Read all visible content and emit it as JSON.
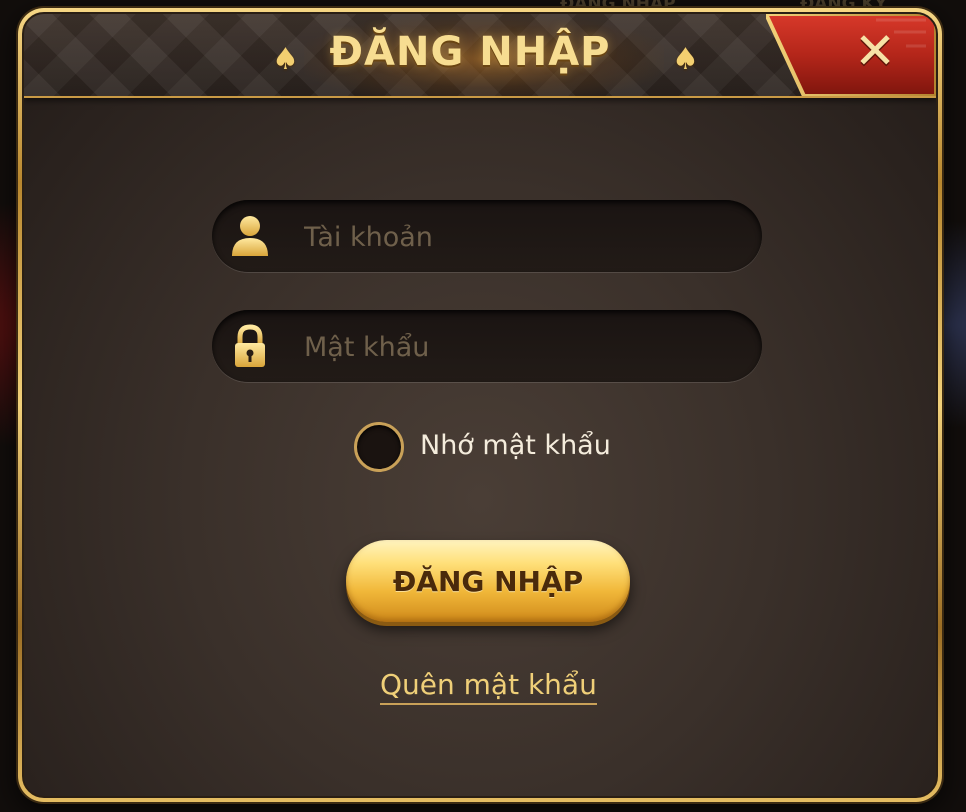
{
  "background": {
    "scraps": [
      "ĐĂNG NHẬP",
      "ĐĂNG KÝ"
    ]
  },
  "dialog": {
    "title": "ĐĂNG NHẬP",
    "decor_glyph": "♠",
    "close_glyph": "✕"
  },
  "form": {
    "username": {
      "value": "",
      "placeholder": "Tài khoản"
    },
    "password": {
      "value": "",
      "placeholder": "Mật khẩu"
    },
    "remember_label": "Nhớ mật khẩu",
    "remember_checked": false,
    "submit_label": "ĐĂNG NHẬP",
    "forgot_label": "Quên mật khẩu"
  },
  "colors": {
    "gold_text": "#f7dd91",
    "button_gold": "#f1b83a",
    "close_red": "#b4261a"
  }
}
